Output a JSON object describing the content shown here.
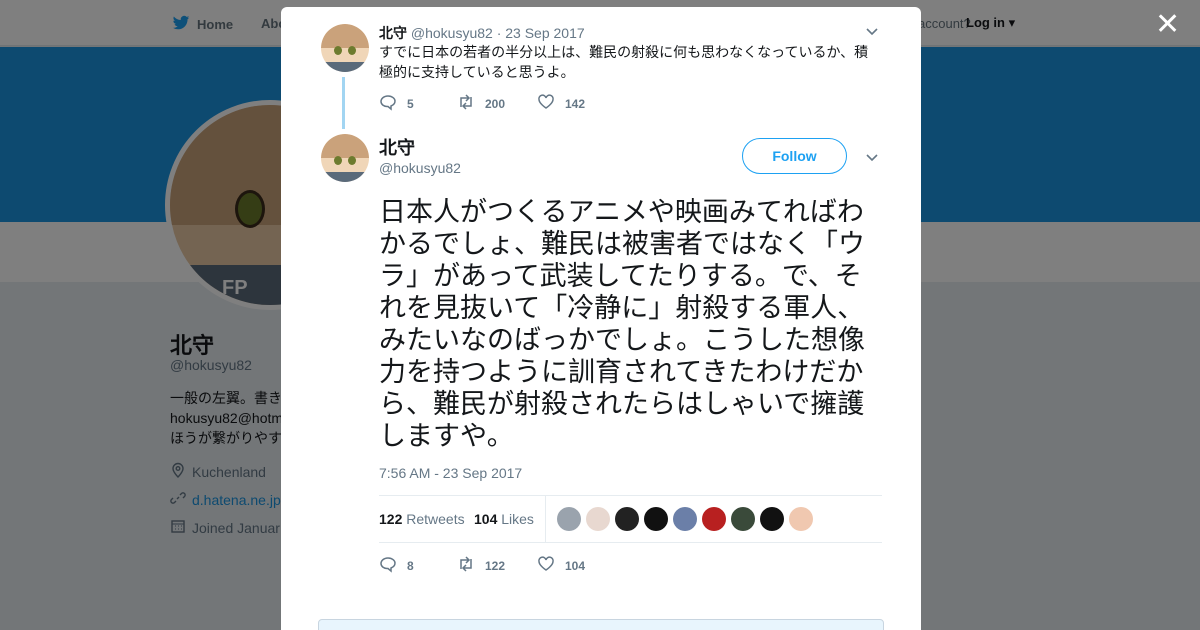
{
  "nav": {
    "home_label": "Home",
    "about_label": "Abo",
    "account_text": "account?",
    "login_label": "Log in"
  },
  "profile": {
    "avatar_text": "FP",
    "name": "北守",
    "handle": "@hokusyu82",
    "bio": "一般の左翼。書き hokusyu82@hotm ほうが繋がりやす",
    "location": "Kuchenland",
    "link": "d.hatena.ne.jp",
    "joined": "Joined Januar"
  },
  "modal": {
    "close_label": "✕",
    "parent_tweet": {
      "name": "北守",
      "meta": "@hokusyu82 · 23 Sep 2017",
      "text": "すでに日本の若者の半分以上は、難民の射殺に何も思わなくなっているか、積極的に支持していると思うよ。",
      "replies": "5",
      "retweets": "200",
      "likes": "142"
    },
    "main_tweet": {
      "name": "北守",
      "handle": "@hokusyu82",
      "follow_label": "Follow",
      "text": "日本人がつくるアニメや映画みてればわかるでしょ、難民は被害者ではなく「ウラ」があって武装してたりする。で、それを見抜いて「冷静に」射殺する軍人、みたいなのばっかでしょ。こうした想像力を持つように訓育されてきたわけだから、難民が射殺されたらはしゃいで擁護しますや。",
      "timestamp": "7:56 AM - 23 Sep 2017",
      "retweet_count": "122",
      "retweet_label": "Retweets",
      "like_count": "104",
      "like_label": "Likes",
      "replies": "8",
      "retweets": "122",
      "likes": "104"
    },
    "likers_colors": [
      "#9aa3ad",
      "#e8d8d0",
      "#222222",
      "#111111",
      "#6b7fa8",
      "#b82020",
      "#3a4a3a",
      "#111111",
      "#f0c8b0"
    ]
  }
}
